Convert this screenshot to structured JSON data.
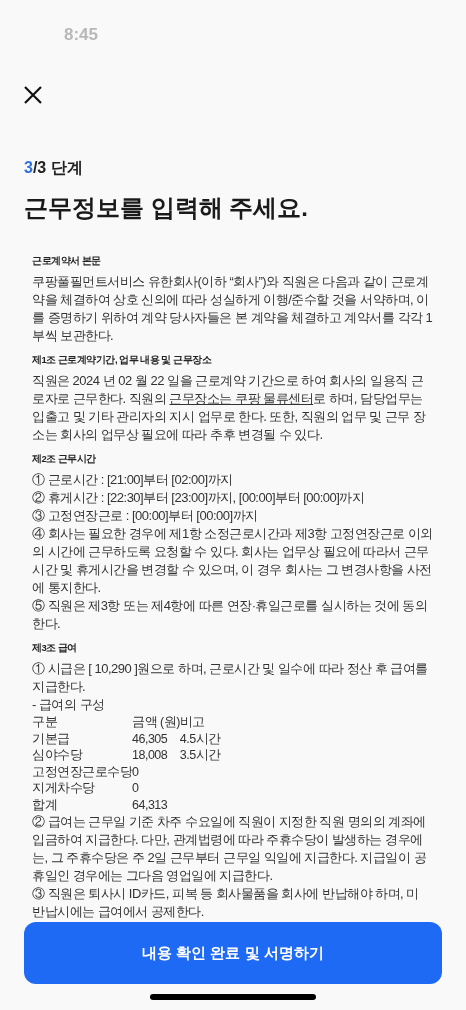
{
  "status_bar": {
    "time": "8:45"
  },
  "step": {
    "current": "3",
    "rest": "/3 단계"
  },
  "title": "근무정보를 입력해 주세요.",
  "sections": [
    {
      "heading": "근로계약서 본문",
      "blocks": [
        {
          "kind": "text",
          "text": "쿠팡풀필먼트서비스 유한회사(이하 “회사”)와 직원은 다음과 같이 근로계약을 체결하여 상호 신의에 따라 성실하게 이행/준수할 것을 서약하며, 이를 증명하기 위하여 계약 당사자들은 본 계약을 체결하고 계약서를 각각 1부씩 보관한다."
        }
      ]
    },
    {
      "heading": "제1조 근로계약기간, 업무 내용 및 근무장소",
      "blocks": [
        {
          "kind": "linked",
          "before": "직원은 2024 년 02 월 22 일을 근로계약 기간으로 하여 회사의 일용직 근로자로 근무한다. 직원의 ",
          "link": "근무장소는 쿠팡 물류센터",
          "after": "로 하며, 담당업무는 입출고 및 기타 관리자의 지시 업무로 한다. 또한, 직원의 업무 및 근무 장소는 회사의 업무상 필요에 따라 추후 변경될 수 있다."
        }
      ]
    },
    {
      "heading": "제2조 근무시간",
      "blocks": [
        {
          "kind": "text",
          "text": "① 근로시간 : [21:00]부터 [02:00]까지"
        },
        {
          "kind": "text",
          "text": "② 휴게시간 : [22:30]부터 [23:00]까지, [00:00]부터 [00:00]까지"
        },
        {
          "kind": "text",
          "text": "③ 고정연장근로 : [00:00]부터 [00:00]까지"
        },
        {
          "kind": "text",
          "text": "④ 회사는 필요한 경우에 제1항 소정근로시간과 제3항 고정연장근로 이외의 시간에 근무하도록 요청할 수 있다. 회사는 업무상 필요에 따라서 근무시간 및 휴게시간을 변경할 수 있으며, 이 경우 회사는 그 변경사항을 사전에 통지한다."
        },
        {
          "kind": "text",
          "text": "⑤ 직원은 제3항 또는 제4항에 따른 연장·휴일근로를 실시하는 것에 동의한다."
        }
      ]
    },
    {
      "heading": "제3조 급여",
      "blocks": [
        {
          "kind": "text",
          "text": "① 시급은 [ 10,290 ]원으로 하며, 근로시간 및 일수에 따라 정산 후 급여를 지급한다."
        },
        {
          "kind": "text",
          "text": "- 급여의 구성"
        },
        {
          "kind": "table",
          "columns": [
            "구분",
            "금액 (원)",
            "비고"
          ],
          "rows": [
            [
              "기본급",
              "46,305",
              "4.5시간"
            ],
            [
              "심야수당",
              "18,008",
              "3.5시간"
            ],
            [
              "고정연장근로수당",
              "0"
            ],
            [
              "지게차수당",
              "0"
            ],
            [
              "합계",
              "64,313"
            ]
          ]
        },
        {
          "kind": "text",
          "text": "② 급여는 근무일 기준 차주 수요일에 직원이 지정한 직원 명의의 계좌에 입금하여 지급한다. 다만, 관계법령에 따라 주휴수당이 발생하는 경우에는, 그 주휴수당은 주 2일 근무부터 근무일 익일에 지급한다. 지급일이 공휴일인 경우에는 그다음 영업일에 지급한다."
        },
        {
          "kind": "text",
          "text": "③ 직원은 퇴사시 ID카드, 피복 등 회사물품을 회사에 반납해야 하며, 미 반납시에는 급여에서 공제한다."
        }
      ]
    }
  ],
  "button": "내용 확인 완료 및 서명하기"
}
